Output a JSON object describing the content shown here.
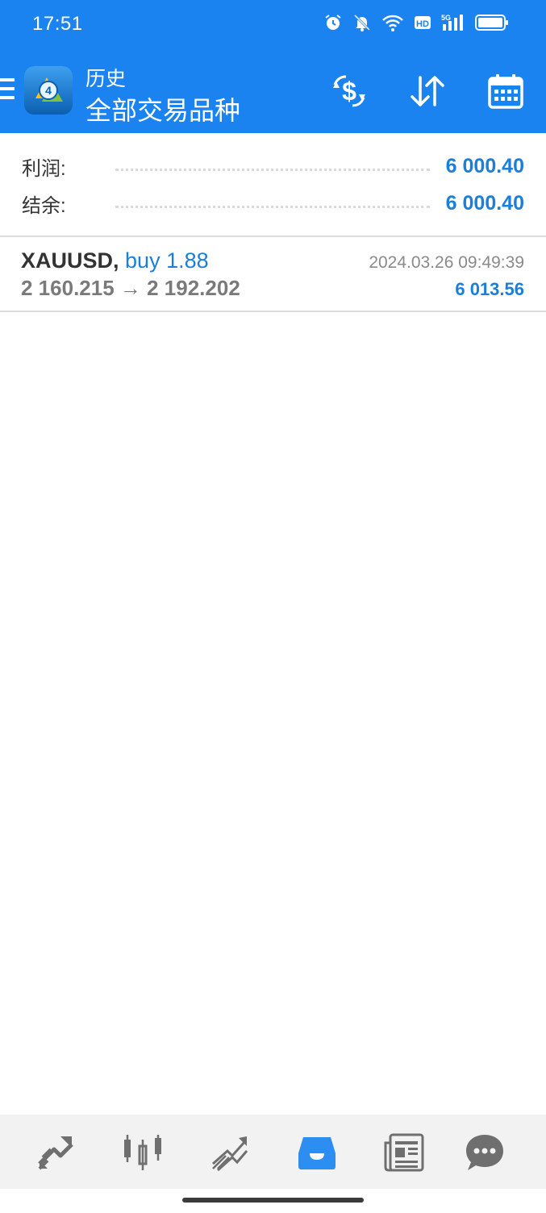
{
  "status_bar": {
    "time": "17:51",
    "icons": [
      "alarm-icon",
      "bell-off-icon",
      "wifi-icon",
      "hd-icon",
      "signal-5g-icon",
      "battery-icon"
    ]
  },
  "header": {
    "subtitle": "历史",
    "title": "全部交易品种",
    "actions": [
      "currency-exchange-icon",
      "sort-icon",
      "calendar-icon"
    ]
  },
  "summary": {
    "profit_label": "利润:",
    "profit_value": "6 000.40",
    "balance_label": "结余:",
    "balance_value": "6 000.40"
  },
  "trades": [
    {
      "symbol": "XAUUSD,",
      "side": "buy 1.88",
      "prices": "2 160.215 → 2 192.202",
      "time": "2024.03.26 09:49:39",
      "profit": "6 013.56"
    }
  ],
  "nav": {
    "items": [
      "quotes-icon",
      "chart-icon",
      "trade-icon",
      "history-icon",
      "news-icon",
      "chat-icon"
    ],
    "active": "history-icon"
  },
  "colors": {
    "accent": "#1a83f0",
    "value_blue": "#1a7fdc",
    "nav_active": "#2b8ef0",
    "nav_inactive": "#6f6f6f"
  }
}
